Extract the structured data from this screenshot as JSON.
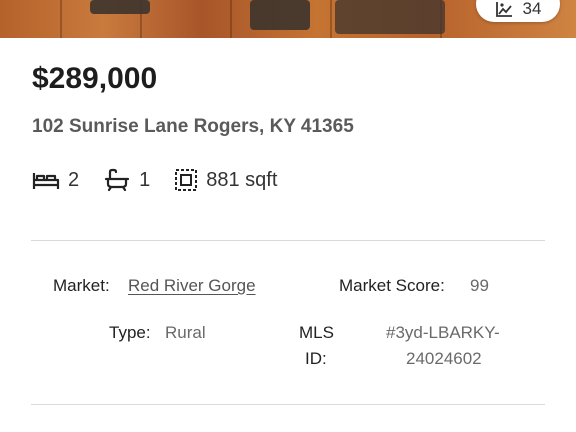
{
  "photo_count": {
    "icon": "gallery-icon",
    "count": "34"
  },
  "listing": {
    "price": "$289,000",
    "address": "102 Sunrise Lane Rogers, KY 41365",
    "beds": "2",
    "baths": "1",
    "sqft": "881 sqft"
  },
  "details": {
    "market_label": "Market:",
    "market_value": "Red River Gorge",
    "market_score_label": "Market Score:",
    "market_score_value": "99",
    "type_label": "Type:",
    "type_value": "Rural",
    "mls_label_1": "MLS",
    "mls_label_2": "ID:",
    "mls_value_1": "#3yd-LBARKY-",
    "mls_value_2": "24024602"
  },
  "icons": {
    "beds": "bed-icon",
    "baths": "bathtub-icon",
    "sqft": "floorplan-icon"
  }
}
